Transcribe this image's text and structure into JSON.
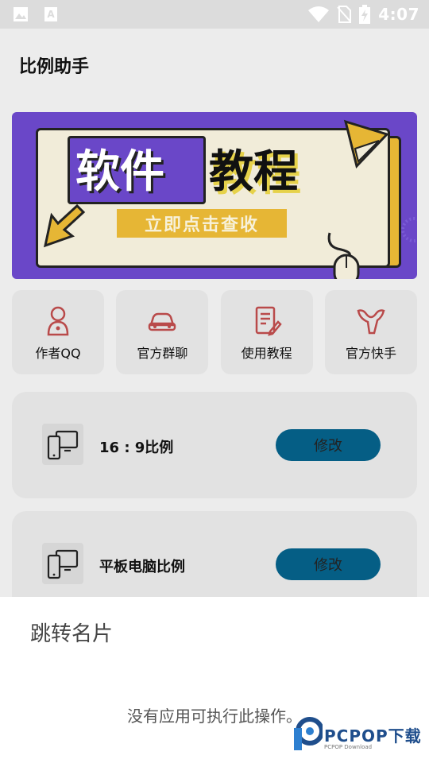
{
  "status_bar": {
    "time": "4:07",
    "icons": [
      "image-icon",
      "text-icon",
      "wifi-icon",
      "no-sim-icon",
      "battery-charging-icon"
    ]
  },
  "app_bar": {
    "title": "比例助手"
  },
  "banner": {
    "title_left": "软件",
    "title_right": "教程",
    "cta": "立即点击查收"
  },
  "quick_links": [
    {
      "label": "作者QQ",
      "icon": "person-icon"
    },
    {
      "label": "官方群聊",
      "icon": "car-icon"
    },
    {
      "label": "使用教程",
      "icon": "document-edit-icon"
    },
    {
      "label": "官方快手",
      "icon": "kuaishou-icon"
    }
  ],
  "ratio_items": [
    {
      "label": "16 : 9比例",
      "button": "修改",
      "icon": "devices-icon"
    },
    {
      "label": "平板电脑比例",
      "button": "修改",
      "icon": "devices-icon"
    }
  ],
  "bottom_sheet": {
    "title": "跳转名片",
    "message": "没有应用可执行此操作。"
  },
  "watermark": {
    "brand": "PCPOP下载",
    "sub": "PCPOP Download"
  },
  "colors": {
    "accent_button": "#055e85",
    "banner_bg": "#6a47c8",
    "banner_yellow": "#e6b635",
    "icon_red": "#b94a4a"
  }
}
